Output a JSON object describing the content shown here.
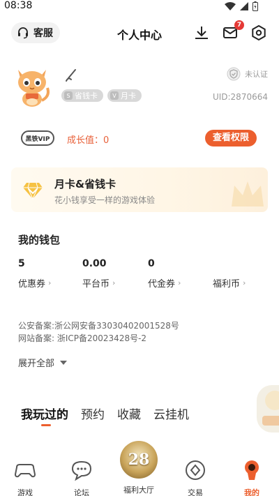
{
  "status_bar": {
    "time": "08:38"
  },
  "header": {
    "customer_service_label": "客服",
    "title": "个人中心",
    "message_badge": "7"
  },
  "profile": {
    "tags": [
      {
        "gem": "S",
        "label": "省钱卡"
      },
      {
        "gem": "V",
        "label": "月卡"
      }
    ],
    "verify_status": "未认证",
    "uid": "UID:2870664"
  },
  "vip": {
    "logo_text": "黑铁VIP",
    "growth_label": "成长值：0",
    "rights_button": "查看权限"
  },
  "card_banner": {
    "title": "月卡&省钱卡",
    "subtitle": "花小钱享受一样的游戏体验"
  },
  "wallet": {
    "title": "我的钱包",
    "items": [
      {
        "value": "5",
        "label": "优惠券"
      },
      {
        "value": "0.00",
        "label": "平台币"
      },
      {
        "value": "0",
        "label": "代金券"
      },
      {
        "value": "",
        "label": "福利币"
      }
    ]
  },
  "icp": {
    "public_security": "公安备案:浙公网安备33030402001528号",
    "website": "网站备案: 浙ICP备20023428号-2",
    "expand_label": "展开全部"
  },
  "tabs": [
    "我玩过的",
    "预约",
    "收藏",
    "云挂机"
  ],
  "bottom_nav": {
    "items": [
      "游戏",
      "论坛",
      "福利大厅",
      "交易",
      "我的"
    ],
    "center_badge": "28",
    "active": "我的"
  },
  "colors": {
    "accent": "#ec5f2e",
    "badge": "#e53935"
  }
}
